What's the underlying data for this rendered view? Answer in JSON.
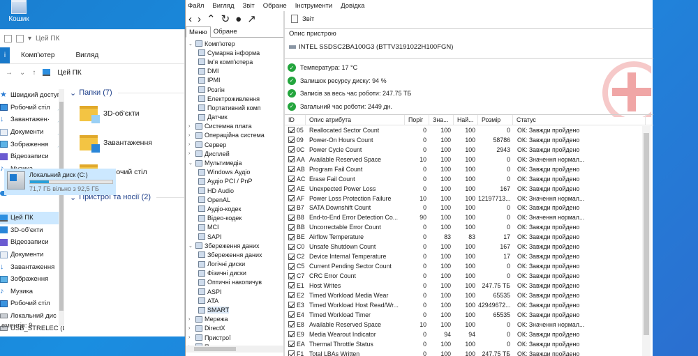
{
  "desktop": {
    "recycle_label": "Кошик"
  },
  "explorer": {
    "title": "Цей ПК",
    "ribbon": [
      "Комп'ютер",
      "Вигляд"
    ],
    "address": "Цей ПК",
    "nav": [
      {
        "label": "Швидкий доступ",
        "icon": "star-icon"
      },
      {
        "label": "Робочий стіл",
        "icon": "desktop-icon",
        "pin": true
      },
      {
        "label": "Завантажен·",
        "icon": "download-icon",
        "pin": true
      },
      {
        "label": "Документи",
        "icon": "documents-icon",
        "pin": true
      },
      {
        "label": "Зображення",
        "icon": "pictures-icon",
        "pin": true
      },
      {
        "label": "Відеозаписи",
        "icon": "videos-icon"
      },
      {
        "label": "Музика",
        "icon": "music-icon"
      },
      {
        "label": "",
        "icon": ""
      },
      {
        "label": "OneDrive",
        "icon": "onedrive-icon"
      },
      {
        "label": "",
        "icon": ""
      },
      {
        "label": "Цей ПК",
        "icon": "pc-icon",
        "selected": true
      },
      {
        "label": "3D-об'єкти",
        "icon": "3d-objects-icon"
      },
      {
        "label": "Відеозаписи",
        "icon": "videos-icon"
      },
      {
        "label": "Документи",
        "icon": "documents-icon"
      },
      {
        "label": "Завантаження",
        "icon": "download-icon"
      },
      {
        "label": "Зображення",
        "icon": "pictures-icon"
      },
      {
        "label": "Музика",
        "icon": "music-icon"
      },
      {
        "label": "Робочий стіл",
        "icon": "desktop-icon"
      },
      {
        "label": "Локальний дис",
        "icon": "drive-icon"
      },
      {
        "label": "USB_STRELEC (D",
        "icon": "usb-drive-icon"
      }
    ],
    "folders_group": "Папки (7)",
    "folders": [
      "3D-об'єкти",
      "Завантаження",
      "Робочий стіл"
    ],
    "devices_group": "Пристрої та носії (2)",
    "drive": {
      "name": "Локальний диск (C:)",
      "free": "71,7 ГБ вільно з 92,5 ГБ",
      "used_fraction": 0.225
    },
    "status": "ементів: 9"
  },
  "aida": {
    "menu": [
      "Файл",
      "Вигляд",
      "Звіт",
      "Обране",
      "Інструменти",
      "Довідка"
    ],
    "panel_tabs": [
      "Меню",
      "Обране"
    ],
    "report_label": "Звіт",
    "tree": [
      {
        "label": "Комп'ютер",
        "lvl": 0,
        "ex": "⌄"
      },
      {
        "label": "Сумарна інформа",
        "lvl": 1
      },
      {
        "label": "Ім'я комп'ютера",
        "lvl": 1
      },
      {
        "label": "DMI",
        "lvl": 1
      },
      {
        "label": "IPMI",
        "lvl": 1
      },
      {
        "label": "Розгін",
        "lvl": 1
      },
      {
        "label": "Електроживлення",
        "lvl": 1
      },
      {
        "label": "Портативний комп",
        "lvl": 1
      },
      {
        "label": "Датчик",
        "lvl": 1
      },
      {
        "label": "Системна плата",
        "lvl": 0,
        "ex": "›"
      },
      {
        "label": "Операційна система",
        "lvl": 0,
        "ex": "›"
      },
      {
        "label": "Сервер",
        "lvl": 0,
        "ex": "›"
      },
      {
        "label": "Дисплей",
        "lvl": 0,
        "ex": "›"
      },
      {
        "label": "Мультимедіа",
        "lvl": 0,
        "ex": "⌄"
      },
      {
        "label": "Windows Аудіо",
        "lvl": 1
      },
      {
        "label": "Аудіо PCI / PnP",
        "lvl": 1
      },
      {
        "label": "HD Audio",
        "lvl": 1
      },
      {
        "label": "OpenAL",
        "lvl": 1
      },
      {
        "label": "Аудіо-кодек",
        "lvl": 1
      },
      {
        "label": "Відео-кодек",
        "lvl": 1
      },
      {
        "label": "MCI",
        "lvl": 1
      },
      {
        "label": "SAPI",
        "lvl": 1
      },
      {
        "label": "Збереження даних",
        "lvl": 0,
        "ex": "⌄"
      },
      {
        "label": "Збереження даних",
        "lvl": 1
      },
      {
        "label": "Логічні диски",
        "lvl": 1
      },
      {
        "label": "Фізичні диски",
        "lvl": 1
      },
      {
        "label": "Оптичні накопичув",
        "lvl": 1
      },
      {
        "label": "ASPI",
        "lvl": 1
      },
      {
        "label": "ATA",
        "lvl": 1
      },
      {
        "label": "SMART",
        "lvl": 1,
        "selected": true
      },
      {
        "label": "Мережа",
        "lvl": 0,
        "ex": "›"
      },
      {
        "label": "DirectX",
        "lvl": 0,
        "ex": "›"
      },
      {
        "label": "Пристрої",
        "lvl": 0,
        "ex": "›"
      },
      {
        "label": "Програми",
        "lvl": 0,
        "ex": "›"
      }
    ],
    "device_desc_label": "Опис пристрою",
    "device_name": "INTEL SSDSC2BA100G3 (BTTV3191022H100FGN)",
    "status_lines": [
      "Температура: 17 °C",
      "Залишок ресурсу диску: 94 %",
      "Записів за весь час роботи: 247.75 ТБ",
      "Загальний час роботи: 2449 дн."
    ],
    "columns": [
      "ID",
      "Опис атрибута",
      "Поріг",
      "Зна...",
      "Най...",
      "Розмір",
      "Статус"
    ],
    "rows": [
      [
        "05",
        "Reallocated Sector Count",
        "0",
        "100",
        "100",
        "0",
        "ОК: Завжди пройдено"
      ],
      [
        "09",
        "Power-On Hours Count",
        "0",
        "100",
        "100",
        "58786",
        "ОК: Завжди пройдено"
      ],
      [
        "0C",
        "Power Cycle Count",
        "0",
        "100",
        "100",
        "2943",
        "ОК: Завжди пройдено"
      ],
      [
        "AA",
        "Available Reserved Space",
        "10",
        "100",
        "100",
        "0",
        "ОК: Значення нормал..."
      ],
      [
        "AB",
        "Program Fail Count",
        "0",
        "100",
        "100",
        "0",
        "ОК: Завжди пройдено"
      ],
      [
        "AC",
        "Erase Fail Count",
        "0",
        "100",
        "100",
        "0",
        "ОК: Завжди пройдено"
      ],
      [
        "AE",
        "Unexpected Power Loss",
        "0",
        "100",
        "100",
        "167",
        "ОК: Завжди пройдено"
      ],
      [
        "AF",
        "Power Loss Protection Failure",
        "10",
        "100",
        "100",
        "12197713...",
        "ОК: Значення нормал..."
      ],
      [
        "B7",
        "SATA Downshift Count",
        "0",
        "100",
        "100",
        "0",
        "ОК: Завжди пройдено"
      ],
      [
        "B8",
        "End-to-End Error Detection Co...",
        "90",
        "100",
        "100",
        "0",
        "ОК: Значення нормал..."
      ],
      [
        "BB",
        "Uncorrectable Error Count",
        "0",
        "100",
        "100",
        "0",
        "ОК: Завжди пройдено"
      ],
      [
        "BE",
        "Airflow Temperature",
        "0",
        "83",
        "83",
        "17",
        "ОК: Завжди пройдено"
      ],
      [
        "C0",
        "Unsafe Shutdown Count",
        "0",
        "100",
        "100",
        "167",
        "ОК: Завжди пройдено"
      ],
      [
        "C2",
        "Device Internal Temperature",
        "0",
        "100",
        "100",
        "17",
        "ОК: Завжди пройдено"
      ],
      [
        "C5",
        "Current Pending Sector Count",
        "0",
        "100",
        "100",
        "0",
        "ОК: Завжди пройдено"
      ],
      [
        "C7",
        "CRC Error Count",
        "0",
        "100",
        "100",
        "0",
        "ОК: Завжди пройдено"
      ],
      [
        "E1",
        "Host Writes",
        "0",
        "100",
        "100",
        "247.75 ТБ",
        "ОК: Завжди пройдено"
      ],
      [
        "E2",
        "Timed Workload Media Wear",
        "0",
        "100",
        "100",
        "65535",
        "ОК: Завжди пройдено"
      ],
      [
        "E3",
        "Timed Workload Host Read/Wr...",
        "0",
        "100",
        "100",
        "42949672...",
        "ОК: Завжди пройдено"
      ],
      [
        "E4",
        "Timed Workload Timer",
        "0",
        "100",
        "100",
        "65535",
        "ОК: Завжди пройдено"
      ],
      [
        "E8",
        "Available Reserved Space",
        "10",
        "100",
        "100",
        "0",
        "ОК: Значення нормал..."
      ],
      [
        "E9",
        "Media Wearout Indicator",
        "0",
        "94",
        "94",
        "0",
        "ОК: Завжди пройдено"
      ],
      [
        "EA",
        "Thermal Throttle Status",
        "0",
        "100",
        "100",
        "0",
        "ОК: Завжди пройдено"
      ],
      [
        "F1",
        "Total LBAs Written",
        "0",
        "100",
        "100",
        "247.75 ТБ",
        "ОК: Завжди пройдено"
      ]
    ]
  }
}
